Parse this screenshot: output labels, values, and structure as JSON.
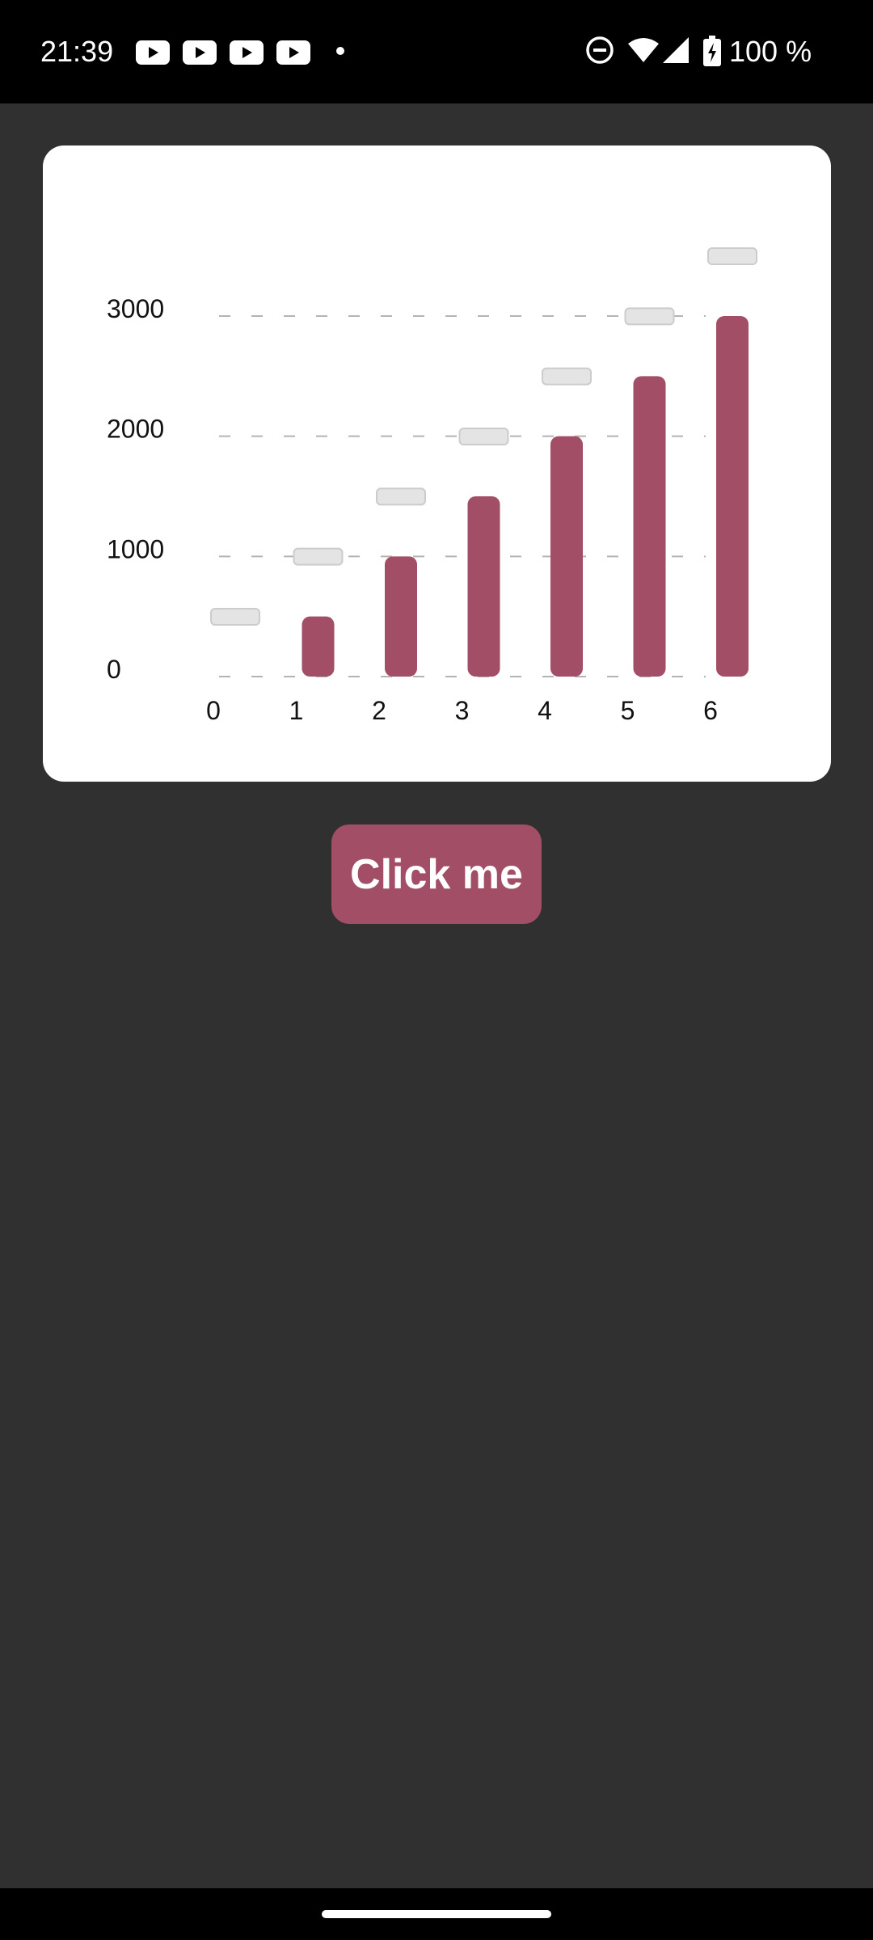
{
  "status_bar": {
    "time": "21:39",
    "notification_icons": [
      "youtube-icon",
      "youtube-icon",
      "youtube-icon",
      "youtube-icon",
      "more-dot-icon"
    ],
    "system_icons": [
      "do-not-disturb-icon",
      "wifi-icon",
      "cell-signal-icon",
      "battery-charging-icon"
    ],
    "battery": "100 %"
  },
  "colors": {
    "bar": "#a34e67",
    "background": "#303030",
    "card": "#ffffff",
    "placeholder": "#e4e4e4",
    "grid": "#b3b3b3"
  },
  "chart_data": {
    "type": "bar",
    "categories": [
      "0",
      "1",
      "2",
      "3",
      "4",
      "5",
      "6"
    ],
    "values": [
      0,
      500,
      1000,
      1500,
      2000,
      2500,
      3000
    ],
    "yticks": [
      "0",
      "1000",
      "2000",
      "3000"
    ],
    "ylim": [
      0,
      3000
    ],
    "grid": true,
    "grid_style": "dashed",
    "legend": "none"
  },
  "button": {
    "label": "Click me"
  }
}
